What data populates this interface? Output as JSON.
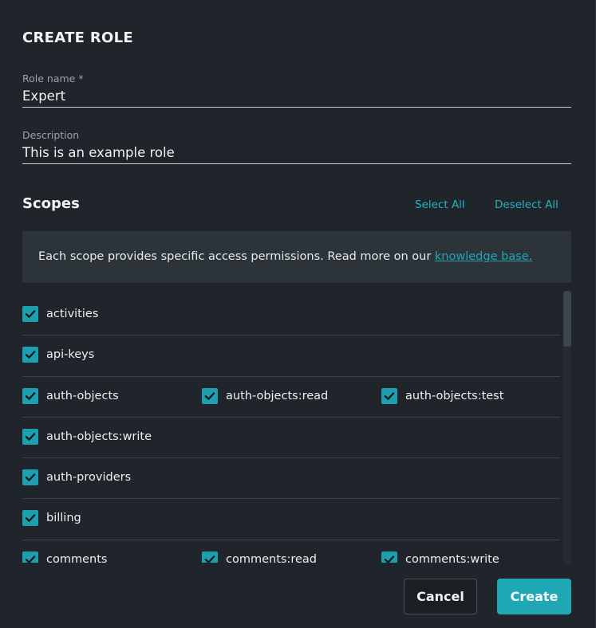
{
  "dialog": {
    "title": "CREATE ROLE",
    "role_name": {
      "label": "Role name *",
      "value": "Expert"
    },
    "description": {
      "label": "Description",
      "value": "This is an example role"
    },
    "scopes": {
      "title": "Scopes",
      "select_all": "Select All",
      "deselect_all": "Deselect All",
      "info_text": "Each scope provides specific access permissions. Read more on our ",
      "info_link": "knowledge base.",
      "rows": [
        [
          {
            "label": "activities",
            "checked": true
          }
        ],
        [
          {
            "label": "api-keys",
            "checked": true
          }
        ],
        [
          {
            "label": "auth-objects",
            "checked": true
          },
          {
            "label": "auth-objects:read",
            "checked": true
          },
          {
            "label": "auth-objects:test",
            "checked": true
          }
        ],
        [
          {
            "label": "auth-objects:write",
            "checked": true
          }
        ],
        [
          {
            "label": "auth-providers",
            "checked": true
          }
        ],
        [
          {
            "label": "billing",
            "checked": true
          }
        ],
        [
          {
            "label": "comments",
            "checked": true
          },
          {
            "label": "comments:read",
            "checked": true
          },
          {
            "label": "comments:write",
            "checked": true
          }
        ]
      ]
    },
    "buttons": {
      "cancel": "Cancel",
      "create": "Create"
    },
    "colors": {
      "accent": "#1fa7b5",
      "background": "#1f252a",
      "panel": "#2c3439"
    },
    "icons": {
      "checkbox": "check-icon"
    }
  }
}
